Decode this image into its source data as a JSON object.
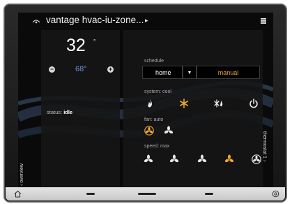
{
  "header": {
    "title": "vantage hvac-iu-zone...",
    "arrow": "▸"
  },
  "temperature": {
    "current": "32",
    "unit": "°",
    "setpoint": "68°",
    "minus": "−",
    "plus": "+"
  },
  "status": {
    "label": "status:",
    "value": "idle"
  },
  "schedule": {
    "label": "schedule",
    "mode": "home",
    "dropdown_arrow": "▼",
    "option": "manual"
  },
  "system": {
    "label": "system:  cool"
  },
  "fan": {
    "label": "fan:  auto"
  },
  "speed": {
    "label": "speed:  max"
  },
  "side": {
    "left": "‹ overview",
    "right": "thermostat 1 ›"
  },
  "colors": {
    "accent": "#f0a830",
    "setpoint": "#6b93d8"
  }
}
